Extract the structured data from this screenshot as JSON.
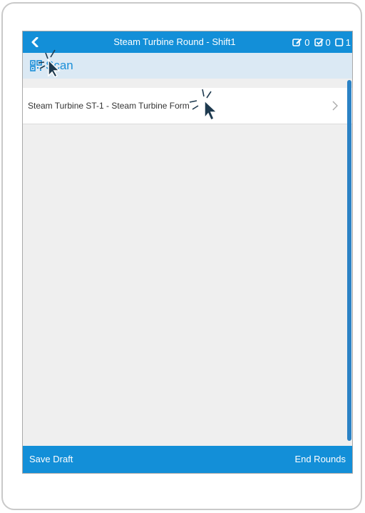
{
  "header": {
    "title": "Steam Turbine Round - Shift1",
    "back_icon": "chevron-left-icon",
    "counters": [
      {
        "icon": "edit-icon",
        "value": "0"
      },
      {
        "icon": "checkbox-checked-icon",
        "value": "0"
      },
      {
        "icon": "checkbox-empty-icon",
        "value": "1"
      }
    ]
  },
  "scan": {
    "icon": "qr-code-icon",
    "label": "Scan"
  },
  "list": {
    "items": [
      {
        "label": "Steam Turbine ST-1 - Steam Turbine Form",
        "icon": "chevron-right-icon"
      }
    ]
  },
  "footer": {
    "save_label": "Save Draft",
    "end_label": "End Rounds"
  },
  "colors": {
    "primary": "#138fd8",
    "scan_bar": "#dbe9f4",
    "background": "#efefef",
    "scrollbar": "#2b82c5"
  }
}
